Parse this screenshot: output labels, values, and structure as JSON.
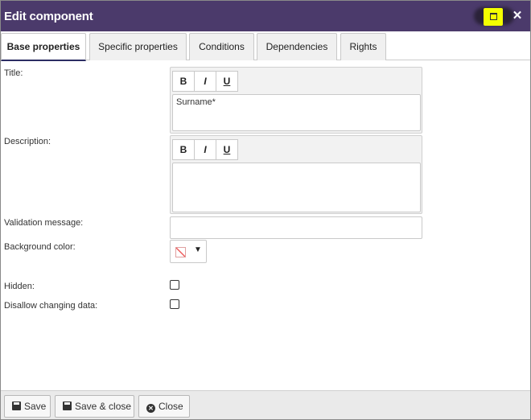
{
  "dialog": {
    "title": "Edit component",
    "maximize_icon": "maximize-icon",
    "close_icon": "close-icon",
    "close_glyph": "✕"
  },
  "tabs": [
    {
      "label": "Base properties",
      "active": true
    },
    {
      "label": "Specific properties",
      "active": false
    },
    {
      "label": "Conditions",
      "active": false
    },
    {
      "label": "Dependencies",
      "active": false
    },
    {
      "label": "Rights",
      "active": false
    }
  ],
  "form": {
    "title_label": "Title:",
    "title_value": "Surname*",
    "description_label": "Description:",
    "description_value": "",
    "validation_label": "Validation message:",
    "validation_value": "",
    "bgcolor_label": "Background color:",
    "hidden_label": "Hidden:",
    "hidden_checked": false,
    "disallow_label": "Disallow changing data:",
    "disallow_checked": false
  },
  "toolbar": {
    "bold": "B",
    "italic": "I",
    "underline": "U"
  },
  "footer": {
    "save": "Save",
    "save_close": "Save & close",
    "close": "Close"
  },
  "colors": {
    "titlebar": "#4b3a6b",
    "highlight": "#f4ff00",
    "active_tab_underline": "#2c2d63"
  }
}
